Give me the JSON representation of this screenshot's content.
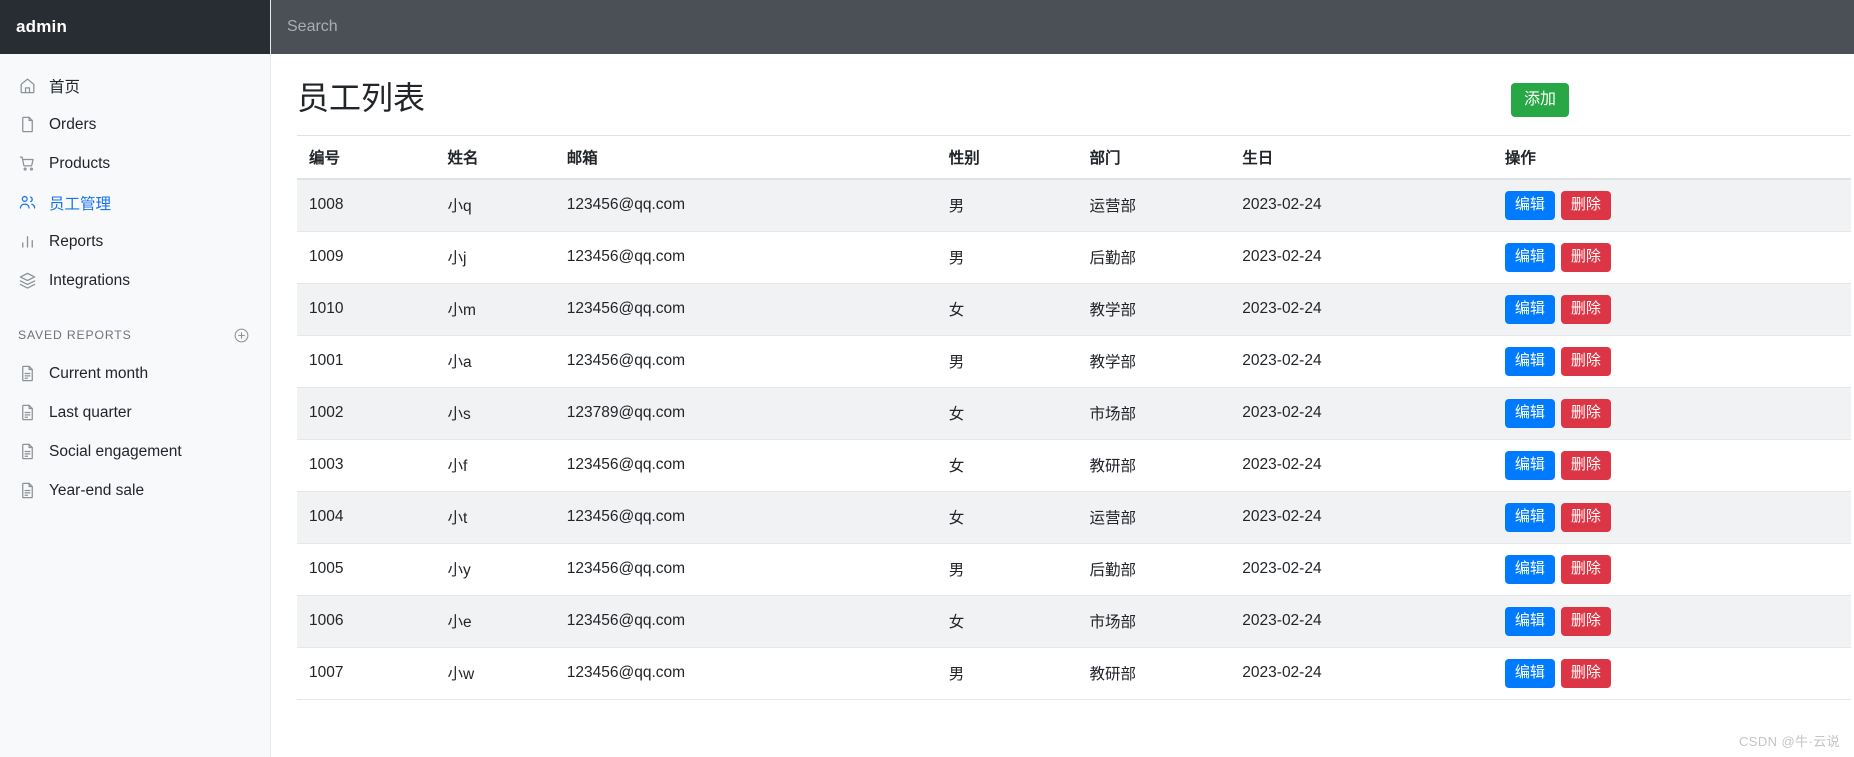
{
  "brand": {
    "title": "admin"
  },
  "search": {
    "placeholder": "Search",
    "value": ""
  },
  "sidebar": {
    "nav": [
      {
        "label": "首页",
        "icon": "home-icon",
        "active": false
      },
      {
        "label": "Orders",
        "icon": "file-icon",
        "active": false
      },
      {
        "label": "Products",
        "icon": "cart-icon",
        "active": false
      },
      {
        "label": "员工管理",
        "icon": "users-icon",
        "active": true
      },
      {
        "label": "Reports",
        "icon": "bar-chart-icon",
        "active": false
      },
      {
        "label": "Integrations",
        "icon": "layers-icon",
        "active": false
      }
    ],
    "saved_section": {
      "title": "SAVED REPORTS",
      "add_icon": "plus-circle-icon"
    },
    "saved": [
      {
        "label": "Current month",
        "icon": "document-icon"
      },
      {
        "label": "Last quarter",
        "icon": "document-icon"
      },
      {
        "label": "Social engagement",
        "icon": "document-icon"
      },
      {
        "label": "Year-end sale",
        "icon": "document-icon"
      }
    ]
  },
  "page": {
    "title": "员工列表",
    "add_label": "添加"
  },
  "table": {
    "columns": [
      "编号",
      "姓名",
      "邮箱",
      "性别",
      "部门",
      "生日",
      "操作"
    ],
    "edit_label": "编辑",
    "delete_label": "删除",
    "rows": [
      {
        "id": "1008",
        "name": "小q",
        "email": "123456@qq.com",
        "sex": "男",
        "dept": "运营部",
        "birthday": "2023-02-24"
      },
      {
        "id": "1009",
        "name": "小j",
        "email": "123456@qq.com",
        "sex": "男",
        "dept": "后勤部",
        "birthday": "2023-02-24"
      },
      {
        "id": "1010",
        "name": "小m",
        "email": "123456@qq.com",
        "sex": "女",
        "dept": "教学部",
        "birthday": "2023-02-24"
      },
      {
        "id": "1001",
        "name": "小a",
        "email": "123456@qq.com",
        "sex": "男",
        "dept": "教学部",
        "birthday": "2023-02-24"
      },
      {
        "id": "1002",
        "name": "小s",
        "email": "123789@qq.com",
        "sex": "女",
        "dept": "市场部",
        "birthday": "2023-02-24"
      },
      {
        "id": "1003",
        "name": "小f",
        "email": "123456@qq.com",
        "sex": "女",
        "dept": "教研部",
        "birthday": "2023-02-24"
      },
      {
        "id": "1004",
        "name": "小t",
        "email": "123456@qq.com",
        "sex": "女",
        "dept": "运营部",
        "birthday": "2023-02-24"
      },
      {
        "id": "1005",
        "name": "小y",
        "email": "123456@qq.com",
        "sex": "男",
        "dept": "后勤部",
        "birthday": "2023-02-24"
      },
      {
        "id": "1006",
        "name": "小e",
        "email": "123456@qq.com",
        "sex": "女",
        "dept": "市场部",
        "birthday": "2023-02-24"
      },
      {
        "id": "1007",
        "name": "小w",
        "email": "123456@qq.com",
        "sex": "男",
        "dept": "教研部",
        "birthday": "2023-02-24"
      }
    ]
  },
  "watermark": {
    "text": "CSDN @牛·云说"
  },
  "colors": {
    "brand_bar": "#282c33",
    "topbar": "#4a5056",
    "sidebar_bg": "#f8f9fb",
    "active_nav": "#1a73e8",
    "add_button": "#28a745",
    "edit_button": "#007bff",
    "delete_button": "#dc3545",
    "row_stripe": "#f1f2f3"
  }
}
